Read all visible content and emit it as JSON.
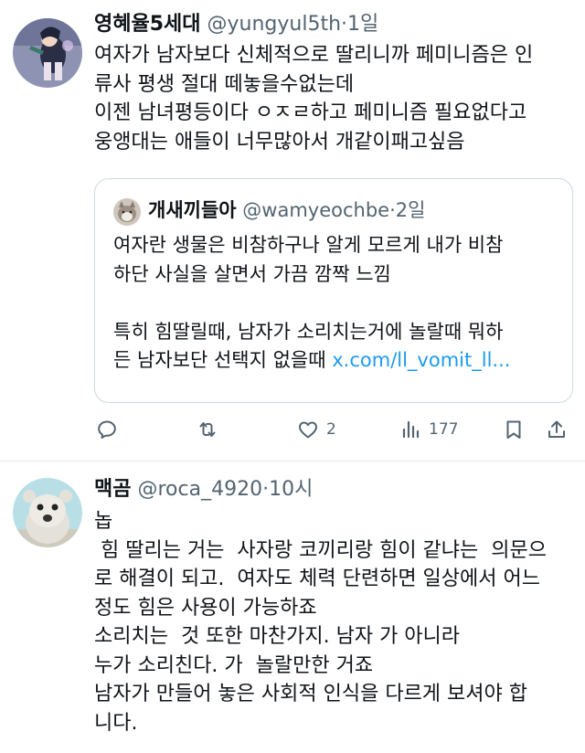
{
  "tweets": [
    {
      "name": "영혜율5세대",
      "handle": "@yungyul5th",
      "dot": "·",
      "time": "1일",
      "text": "여자가 남자보다 신체적으로 딸리니까 페미니즘은 인\n류사 평생 절대 떼놓을수없는데\n이젠 남녀평등이다 ㅇㅈㄹ하고 페미니즘 필요없다고\n웅앵대는 애들이 너무많아서 개같이패고싶음",
      "quote": {
        "name": "개새끼들아",
        "handle": "@wamyeochbe",
        "dot": "·",
        "time": "2일",
        "text": "여자란 생물은 비참하구나 알게 모르게 내가 비참\n하단 사실을 살면서 가끔 깜짝 느낌\n\n특히 힘딸릴때, 남자가 소리치는거에 놀랄때 뭐하\n든 남자보단 선택지 없을때 ",
        "link": "x.com/ll_vomit_ll..."
      },
      "actions": {
        "reply_icon": "reply-icon",
        "retweet_icon": "retweet-icon",
        "like_icon": "like-icon",
        "like_count": "2",
        "views_icon": "views-icon",
        "views_count": "177",
        "bookmark_icon": "bookmark-icon",
        "share_icon": "share-icon"
      }
    },
    {
      "name": "맥곰",
      "handle": "@roca_4920",
      "dot": "·",
      "time": "10시",
      "text": "놉\n 힘 딸리는 거는  사자랑 코끼리랑 힘이 같냐는  의문으\n로 해결이 되고.  여자도 체력 단련하면 일상에서 어느\n정도 힘은 사용이 가능하죠\n소리치는  것 또한 마찬가지. 남자 가 아니라\n누가 소리친다. 가  놀랄만한 거죠\n남자가 만들어 놓은 사회적 인식을 다르게 보셔야 합\n니다."
    }
  ],
  "colors": {
    "text": "#0f1419",
    "secondary": "#536471",
    "link": "#1d9bf0",
    "border": "#cfd9de",
    "divider": "#e7e9ea"
  }
}
